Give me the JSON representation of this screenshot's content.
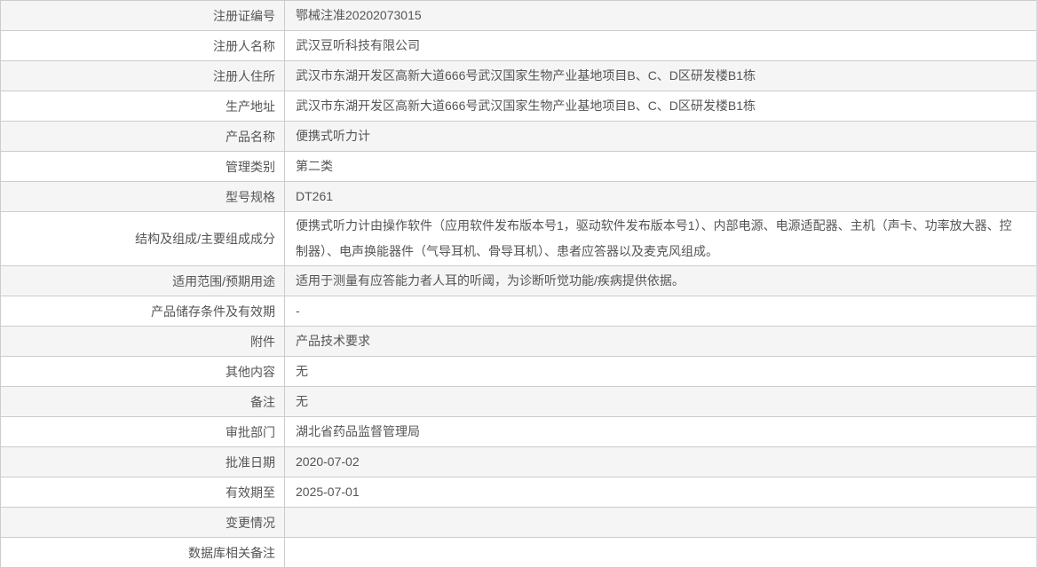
{
  "table": {
    "rows": [
      {
        "label": "注册证编号",
        "value": "鄂械注准20202073015"
      },
      {
        "label": "注册人名称",
        "value": "武汉豆听科技有限公司"
      },
      {
        "label": "注册人住所",
        "value": "武汉市东湖开发区高新大道666号武汉国家生物产业基地项目B、C、D区研发楼B1栋"
      },
      {
        "label": "生产地址",
        "value": "武汉市东湖开发区高新大道666号武汉国家生物产业基地项目B、C、D区研发楼B1栋"
      },
      {
        "label": "产品名称",
        "value": "便携式听力计"
      },
      {
        "label": "管理类别",
        "value": "第二类"
      },
      {
        "label": "型号规格",
        "value": "DT261"
      },
      {
        "label": "结构及组成/主要组成成分",
        "value": "便携式听力计由操作软件（应用软件发布版本号1，驱动软件发布版本号1）、内部电源、电源适配器、主机（声卡、功率放大器、控制器）、电声换能器件（气导耳机、骨导耳机）、患者应答器以及麦克风组成。"
      },
      {
        "label": "适用范围/预期用途",
        "value": "适用于测量有应答能力者人耳的听阈，为诊断听觉功能/疾病提供依据。"
      },
      {
        "label": "产品储存条件及有效期",
        "value": "-"
      },
      {
        "label": "附件",
        "value": "产品技术要求"
      },
      {
        "label": "其他内容",
        "value": "无"
      },
      {
        "label": "备注",
        "value": "无"
      },
      {
        "label": "审批部门",
        "value": "湖北省药品监督管理局"
      },
      {
        "label": "批准日期",
        "value": "2020-07-02"
      },
      {
        "label": "有效期至",
        "value": "2025-07-01"
      },
      {
        "label": "变更情况",
        "value": ""
      },
      {
        "label": "数据库相关备注",
        "value": ""
      }
    ]
  },
  "colors": {
    "border": "#cccccc",
    "row_alt_background": "#f5f5f6",
    "text": "#555555"
  }
}
